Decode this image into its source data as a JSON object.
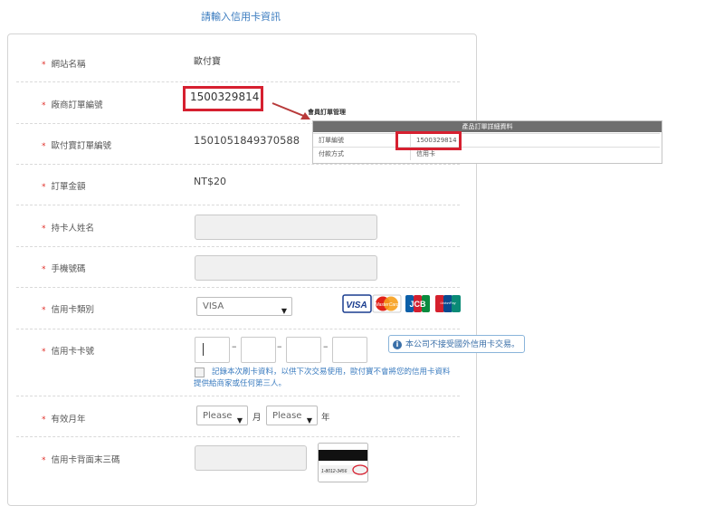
{
  "page_title": "請輸入信用卡資訊",
  "required_mark": "*",
  "fields": {
    "site_name": {
      "label": "網站名稱",
      "value": "歐付寶"
    },
    "merchant_order": {
      "label": "廠商訂單編號",
      "value": "1500329814"
    },
    "allpay_order": {
      "label": "歐付寶訂單編號",
      "value": "1501051849370588"
    },
    "amount": {
      "label": "訂單金額",
      "value": "NT$20"
    },
    "holder_name": {
      "label": "持卡人姓名",
      "value": ""
    },
    "phone": {
      "label": "手機號碼",
      "value": ""
    },
    "card_type": {
      "label": "信用卡類別",
      "value": "VISA"
    },
    "card_number": {
      "label": "信用卡卡號",
      "value": ""
    },
    "expiry": {
      "label": "有效月年",
      "month": "Please",
      "month_unit": "月",
      "year": "Please",
      "year_unit": "年"
    },
    "cvv": {
      "label": "信用卡背面末三碼",
      "value": ""
    }
  },
  "remember_card_text": "記錄本次刷卡資料，以供下次交易使用，歐付寶不會將您的信用卡資料提供給商家或任何第三人。",
  "card_brands": [
    "VISA",
    "MasterCard",
    "JCB",
    "UnionPay"
  ],
  "cvv_sample_text": "1-8012-3456",
  "foreign_card_notice": "本公司不接受國外信用卡交易。",
  "admin_popup": {
    "caption": "會員訂單管理",
    "header": "產品訂單詳細資料",
    "rows": [
      {
        "key": "訂單編號",
        "value": "1500329814"
      },
      {
        "key": "付款方式",
        "value": "信用卡"
      }
    ]
  },
  "colors": {
    "accent": "#3a7bbf",
    "highlight": "#d62030",
    "required": "#e0302a"
  }
}
